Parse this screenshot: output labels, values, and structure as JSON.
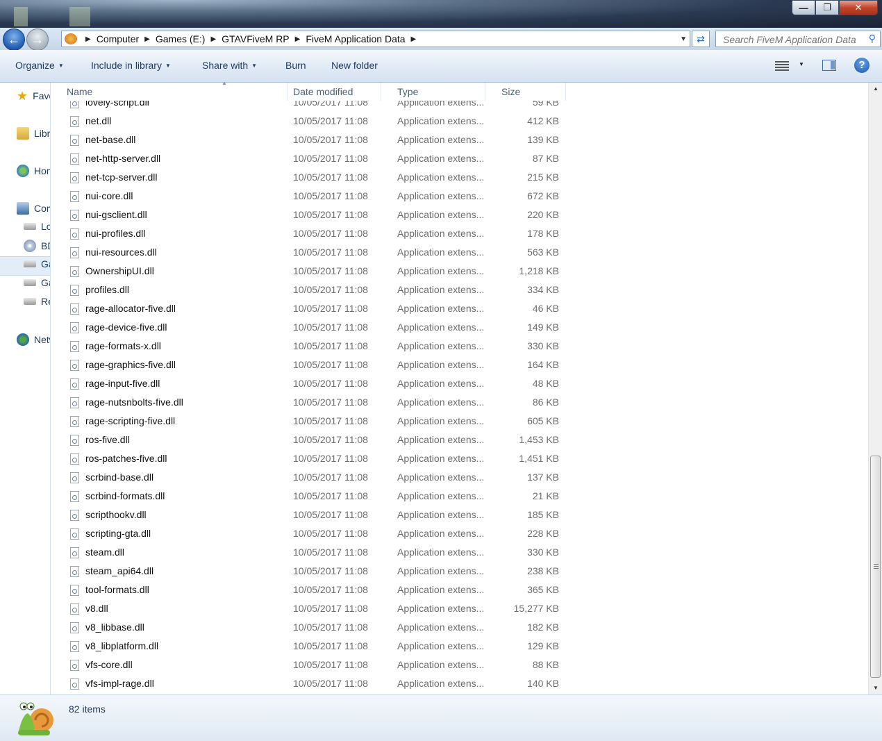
{
  "window": {
    "buttons": {
      "minimize": "—",
      "maximize": "❐",
      "close": "✕"
    }
  },
  "address": {
    "crumbs": [
      "Computer",
      "Games (E:)",
      "GTAVFiveM RP",
      "FiveM Application Data"
    ],
    "search_placeholder": "Search FiveM Application Data"
  },
  "toolbar": {
    "organize": "Organize",
    "include_in_library": "Include in library",
    "share_with": "Share with",
    "burn": "Burn",
    "new_folder": "New folder"
  },
  "navpane": {
    "items": [
      {
        "label": "Favorites",
        "icon": "star-icon"
      },
      {
        "label": "Libraries",
        "icon": "library-icon"
      },
      {
        "label": "Homegroup",
        "icon": "homegroup-icon"
      },
      {
        "label": "Computer",
        "icon": "computer-icon"
      },
      {
        "label": "Local Disk",
        "icon": "local-disk-icon"
      },
      {
        "label": "BD-ROM",
        "icon": "dvd-drive-icon"
      },
      {
        "label": "Games",
        "icon": "drive-icon"
      },
      {
        "label": "Games",
        "icon": "drive-icon"
      },
      {
        "label": "Removable",
        "icon": "removable-drive-icon"
      },
      {
        "label": "Network",
        "icon": "network-icon"
      }
    ]
  },
  "columns": {
    "name": "Name",
    "date": "Date modified",
    "type": "Type",
    "size": "Size"
  },
  "files": [
    {
      "name": "lovely-script.dll",
      "date": "10/05/2017 11:08",
      "type": "Application extens...",
      "size": "59 KB"
    },
    {
      "name": "net.dll",
      "date": "10/05/2017 11:08",
      "type": "Application extens...",
      "size": "412 KB"
    },
    {
      "name": "net-base.dll",
      "date": "10/05/2017 11:08",
      "type": "Application extens...",
      "size": "139 KB"
    },
    {
      "name": "net-http-server.dll",
      "date": "10/05/2017 11:08",
      "type": "Application extens...",
      "size": "87 KB"
    },
    {
      "name": "net-tcp-server.dll",
      "date": "10/05/2017 11:08",
      "type": "Application extens...",
      "size": "215 KB"
    },
    {
      "name": "nui-core.dll",
      "date": "10/05/2017 11:08",
      "type": "Application extens...",
      "size": "672 KB"
    },
    {
      "name": "nui-gsclient.dll",
      "date": "10/05/2017 11:08",
      "type": "Application extens...",
      "size": "220 KB"
    },
    {
      "name": "nui-profiles.dll",
      "date": "10/05/2017 11:08",
      "type": "Application extens...",
      "size": "178 KB"
    },
    {
      "name": "nui-resources.dll",
      "date": "10/05/2017 11:08",
      "type": "Application extens...",
      "size": "563 KB"
    },
    {
      "name": "OwnershipUI.dll",
      "date": "10/05/2017 11:08",
      "type": "Application extens...",
      "size": "1,218 KB"
    },
    {
      "name": "profiles.dll",
      "date": "10/05/2017 11:08",
      "type": "Application extens...",
      "size": "334 KB"
    },
    {
      "name": "rage-allocator-five.dll",
      "date": "10/05/2017 11:08",
      "type": "Application extens...",
      "size": "46 KB"
    },
    {
      "name": "rage-device-five.dll",
      "date": "10/05/2017 11:08",
      "type": "Application extens...",
      "size": "149 KB"
    },
    {
      "name": "rage-formats-x.dll",
      "date": "10/05/2017 11:08",
      "type": "Application extens...",
      "size": "330 KB"
    },
    {
      "name": "rage-graphics-five.dll",
      "date": "10/05/2017 11:08",
      "type": "Application extens...",
      "size": "164 KB"
    },
    {
      "name": "rage-input-five.dll",
      "date": "10/05/2017 11:08",
      "type": "Application extens...",
      "size": "48 KB"
    },
    {
      "name": "rage-nutsnbolts-five.dll",
      "date": "10/05/2017 11:08",
      "type": "Application extens...",
      "size": "86 KB"
    },
    {
      "name": "rage-scripting-five.dll",
      "date": "10/05/2017 11:08",
      "type": "Application extens...",
      "size": "605 KB"
    },
    {
      "name": "ros-five.dll",
      "date": "10/05/2017 11:08",
      "type": "Application extens...",
      "size": "1,453 KB"
    },
    {
      "name": "ros-patches-five.dll",
      "date": "10/05/2017 11:08",
      "type": "Application extens...",
      "size": "1,451 KB"
    },
    {
      "name": "scrbind-base.dll",
      "date": "10/05/2017 11:08",
      "type": "Application extens...",
      "size": "137 KB"
    },
    {
      "name": "scrbind-formats.dll",
      "date": "10/05/2017 11:08",
      "type": "Application extens...",
      "size": "21 KB"
    },
    {
      "name": "scripthookv.dll",
      "date": "10/05/2017 11:08",
      "type": "Application extens...",
      "size": "185 KB"
    },
    {
      "name": "scripting-gta.dll",
      "date": "10/05/2017 11:08",
      "type": "Application extens...",
      "size": "228 KB"
    },
    {
      "name": "steam.dll",
      "date": "10/05/2017 11:08",
      "type": "Application extens...",
      "size": "330 KB"
    },
    {
      "name": "steam_api64.dll",
      "date": "10/05/2017 11:08",
      "type": "Application extens...",
      "size": "238 KB"
    },
    {
      "name": "tool-formats.dll",
      "date": "10/05/2017 11:08",
      "type": "Application extens...",
      "size": "365 KB"
    },
    {
      "name": "v8.dll",
      "date": "10/05/2017 11:08",
      "type": "Application extens...",
      "size": "15,277 KB"
    },
    {
      "name": "v8_libbase.dll",
      "date": "10/05/2017 11:08",
      "type": "Application extens...",
      "size": "182 KB"
    },
    {
      "name": "v8_libplatform.dll",
      "date": "10/05/2017 11:08",
      "type": "Application extens...",
      "size": "129 KB"
    },
    {
      "name": "vfs-core.dll",
      "date": "10/05/2017 11:08",
      "type": "Application extens...",
      "size": "88 KB"
    },
    {
      "name": "vfs-impl-rage.dll",
      "date": "10/05/2017 11:08",
      "type": "Application extens...",
      "size": "140 KB"
    }
  ],
  "status": {
    "item_count": "82 items"
  }
}
